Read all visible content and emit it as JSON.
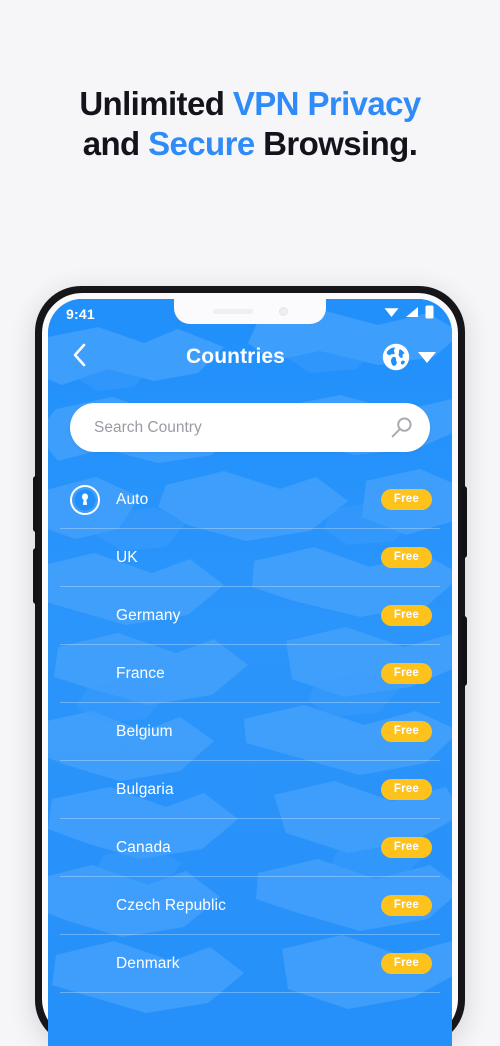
{
  "headline": {
    "line1": [
      {
        "text": "Unlimited ",
        "accent": false
      },
      {
        "text": "VPN Privacy",
        "accent": true
      }
    ],
    "line2": [
      {
        "text": "and ",
        "accent": false
      },
      {
        "text": "Secure",
        "accent": true
      },
      {
        "text": " Browsing.",
        "accent": false
      }
    ]
  },
  "colors": {
    "page_background": "#f6f5f7",
    "headline_text": "#13131c",
    "headline_accent": "#2f8bf7",
    "app_blue": "#2190fb",
    "map_land": "#4ea6fc",
    "badge_yellow": "#fdc31c",
    "badge_text": "#ffffff",
    "frame_black": "#16161a"
  },
  "status_bar": {
    "time": "9:41",
    "icons": [
      "wifi-icon",
      "signal-icon",
      "battery-icon"
    ]
  },
  "app_header": {
    "back_icon": "chevron-left-icon",
    "title": "Countries",
    "globe_icon": "globe-icon",
    "dropdown_icon": "caret-down-icon"
  },
  "search": {
    "placeholder": "Search Country",
    "value": "",
    "icon": "search-icon"
  },
  "list": {
    "badge_label": "Free",
    "rows": [
      {
        "name": "Auto",
        "badge": "Free",
        "icon": "lock-shield-icon"
      },
      {
        "name": "UK",
        "badge": "Free",
        "icon": ""
      },
      {
        "name": "Germany",
        "badge": "Free",
        "icon": ""
      },
      {
        "name": "France",
        "badge": "Free",
        "icon": ""
      },
      {
        "name": "Belgium",
        "badge": "Free",
        "icon": ""
      },
      {
        "name": "Bulgaria",
        "badge": "Free",
        "icon": ""
      },
      {
        "name": "Canada",
        "badge": "Free",
        "icon": ""
      },
      {
        "name": "Czech Republic",
        "badge": "Free",
        "icon": ""
      },
      {
        "name": "Denmark",
        "badge": "Free",
        "icon": ""
      }
    ]
  }
}
